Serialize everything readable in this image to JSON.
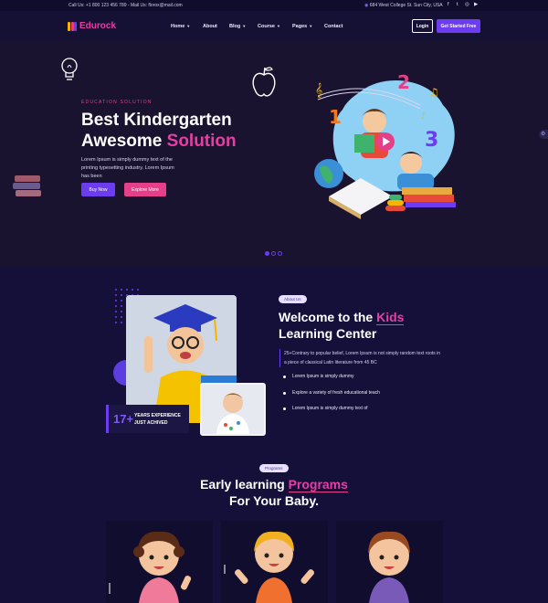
{
  "topbar": {
    "contact": "Call Us: +1 800 123 456 789 - Mail Us: florox@mail.com",
    "address": "684 West College St. Sun City, USA",
    "social": [
      {
        "icon": "facebook-icon",
        "glyph": "f"
      },
      {
        "icon": "twitter-icon",
        "glyph": "t"
      },
      {
        "icon": "instagram-icon",
        "glyph": "◎"
      },
      {
        "icon": "youtube-icon",
        "glyph": "▶"
      }
    ]
  },
  "nav": {
    "logo_text": "Edurock",
    "menu": [
      {
        "label": "Home",
        "dropdown": true
      },
      {
        "label": "About",
        "dropdown": false
      },
      {
        "label": "Blog",
        "dropdown": true
      },
      {
        "label": "Course",
        "dropdown": true
      },
      {
        "label": "Pages",
        "dropdown": true
      },
      {
        "label": "Contact",
        "dropdown": false
      }
    ],
    "login_label": "Login",
    "cta_label": "Get Started Free"
  },
  "hero": {
    "eyebrow": "EDUCATION SOLUTION",
    "title_line1": "Best Kindergarten",
    "title_line2_plain": "Awesome ",
    "title_line2_accent": "Solution",
    "description": "Lorem Ipsum is simply dummy text of the printing typesetting industry. Lorem Ipsum has been",
    "buy_label": "Buy Now",
    "explore_label": "Explore More",
    "slides": 3,
    "active_slide": 1
  },
  "about": {
    "chip": "About Us",
    "title_line1_plain": "Welcome to the ",
    "title_line1_accent": "Kids",
    "title_line2": "Learning Center",
    "paragraph": "25+Contrary to popular belief, Lorem Ipsum is not simply random text roots in a piece of classical Latin literature from 45 BC",
    "features": [
      "Lorem Ipsum is simply dummy",
      "Explore a variety of fresh educational teach",
      "Lorem Ipsum is simply dummy text of"
    ],
    "experience_number": "17+",
    "experience_label": "YEARS EXPERIENCE JUST ACHIVED"
  },
  "programs": {
    "chip": "Programs",
    "title_line1_plain": "Early learning ",
    "title_line1_accent": "Programs",
    "title_line2": "For Your Baby."
  },
  "colors": {
    "background": "#14103a",
    "accent_purple": "#6b3cf0",
    "accent_pink": "#e53f8a"
  }
}
